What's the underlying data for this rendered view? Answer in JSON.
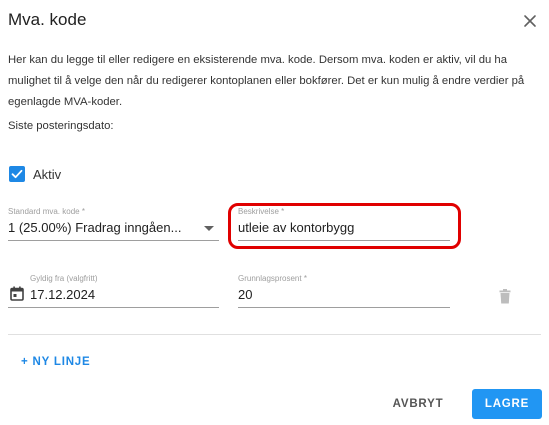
{
  "dialog": {
    "title": "Mva. kode",
    "close_icon": "close-icon",
    "intro": "Her kan du legge til eller redigere en eksisterende mva. kode. Dersom mva. koden er aktiv, vil du ha mulighet til å velge den når du redigerer kontoplanen eller bokfører. Det er kun mulig å endre verdier på egenlagde MVA-koder.",
    "last_posting_label": "Siste posteringsdato:",
    "active": {
      "label": "Aktiv",
      "checked": true
    }
  },
  "fields": {
    "standard_code": {
      "label": "Standard mva. kode *",
      "value": "1 (25.00%) Fradrag inngåen..."
    },
    "description": {
      "label": "Beskrivelse *",
      "value": "utleie av kontorbygg"
    },
    "valid_from": {
      "label": "Gyldig fra (valgfritt)",
      "value": "17.12.2024",
      "icon": "calendar-icon"
    },
    "base_percent": {
      "label": "Grunnlagsprosent *",
      "value": "20"
    }
  },
  "actions": {
    "add_line": "+ NY LINJE",
    "cancel": "AVBRYT",
    "save": "LAGRE",
    "delete_icon": "trash-icon"
  },
  "colors": {
    "accent": "#2196f3",
    "checkbox": "#1e88e5",
    "highlight": "#e00000"
  }
}
